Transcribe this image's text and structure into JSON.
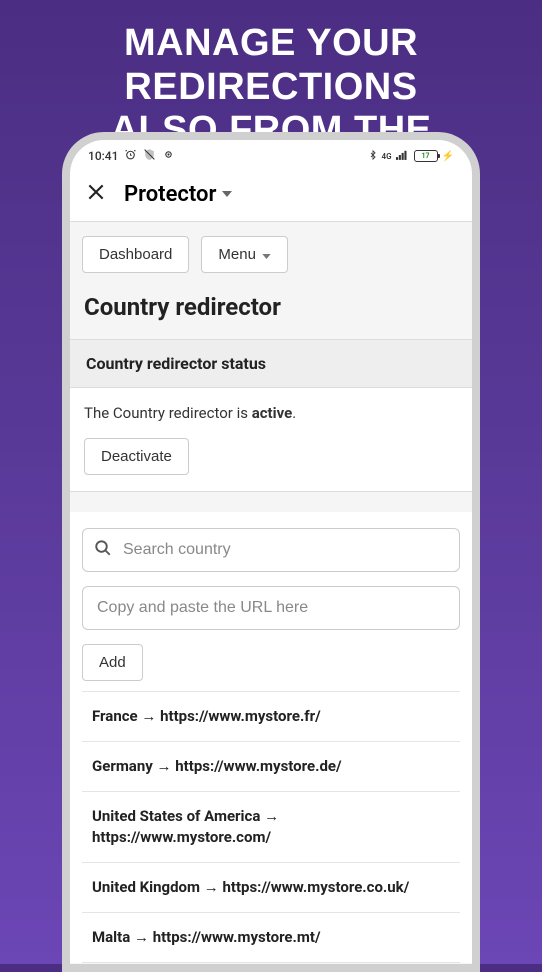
{
  "marketing": {
    "line1": "Manage your redirections",
    "line2": "also from the smartphone"
  },
  "statusbar": {
    "time": "10:41",
    "battery": "17"
  },
  "header": {
    "title": "Protector"
  },
  "toolbar": {
    "dashboard": "Dashboard",
    "menu": "Menu"
  },
  "page": {
    "title": "Country redirector",
    "status_header": "Country redirector status",
    "status_prefix": "The Country redirector is ",
    "status_value": "active",
    "status_suffix": ".",
    "deactivate": "Deactivate"
  },
  "form": {
    "search_placeholder": "Search country",
    "url_placeholder": "Copy and paste the URL here",
    "add": "Add"
  },
  "rows": [
    {
      "country": "France",
      "url": "https://www.mystore.fr/"
    },
    {
      "country": "Germany",
      "url": "https://www.mystore.de/"
    },
    {
      "country": "United States of America",
      "url": "https://www.mystore.com/"
    },
    {
      "country": "United Kingdom",
      "url": "https://www.mystore.co.uk/"
    },
    {
      "country": "Malta",
      "url": "https://www.mystore.mt/"
    }
  ]
}
